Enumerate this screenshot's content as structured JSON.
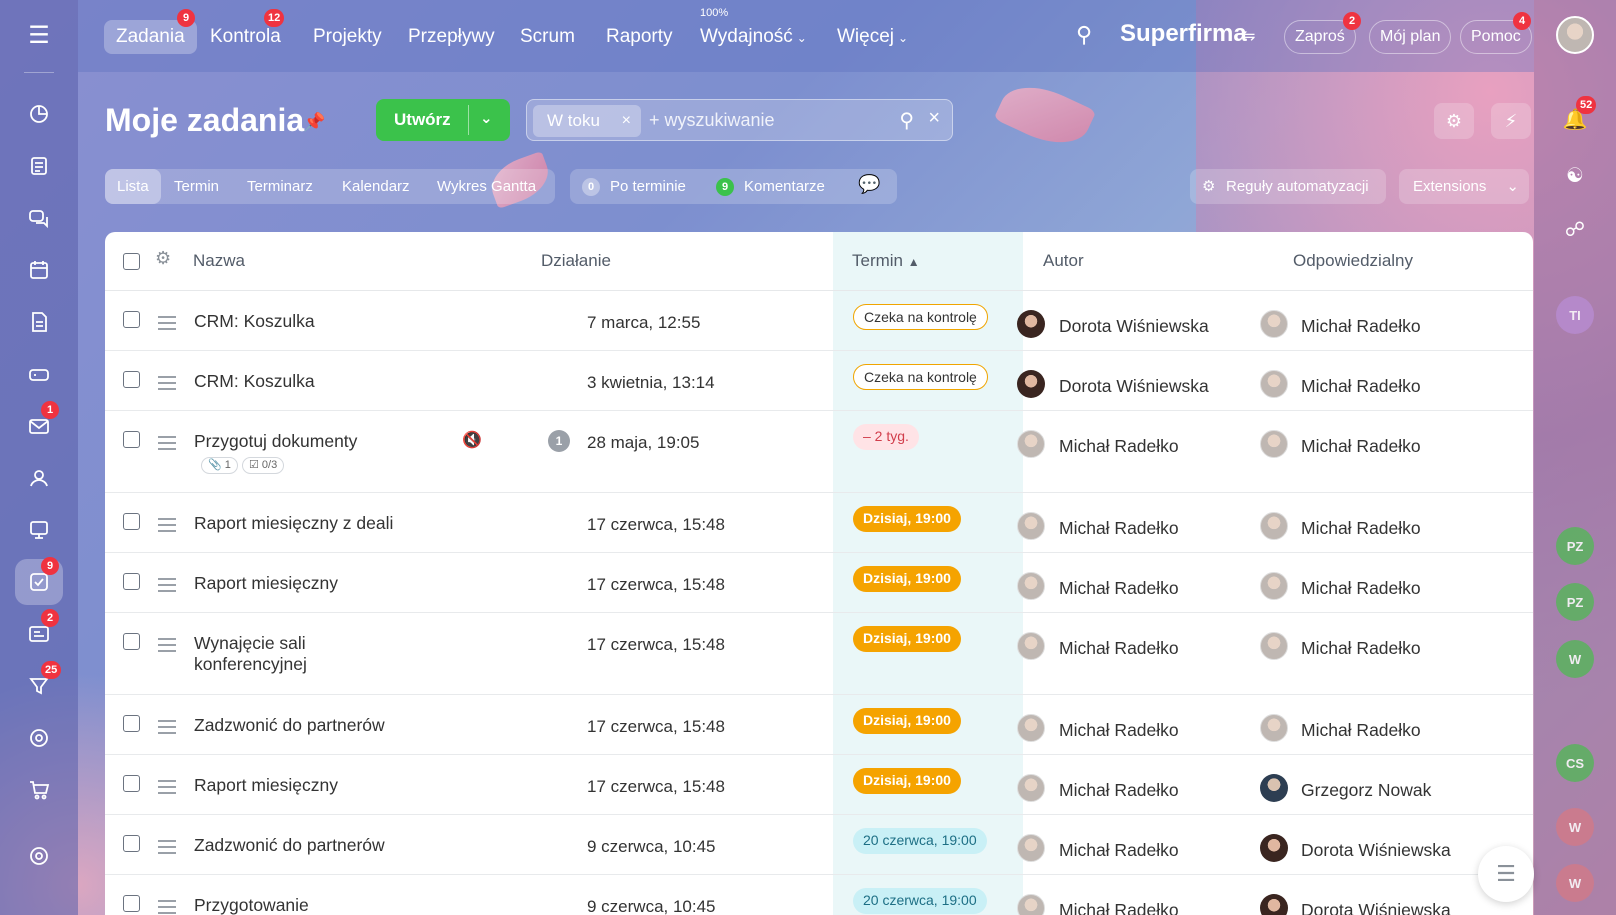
{
  "nav": {
    "tabs": [
      {
        "label": "Zadania",
        "badge": "9"
      },
      {
        "label": "Kontrola",
        "badge": "12"
      },
      {
        "label": "Projekty"
      },
      {
        "label": "Przepływy"
      },
      {
        "label": "Scrum"
      },
      {
        "label": "Raporty"
      },
      {
        "label": "Wydajność",
        "sup": "100%"
      },
      {
        "label": "Więcej"
      }
    ],
    "company": "Superfirma",
    "invite": "Zaproś",
    "invite_badge": "2",
    "my_plan": "Mój plan",
    "help": "Pomoc",
    "help_badge": "4"
  },
  "sidebar": {
    "items": [
      {
        "icon": "chart-icon"
      },
      {
        "icon": "feed-icon"
      },
      {
        "icon": "chat-icon"
      },
      {
        "icon": "calendar-icon"
      },
      {
        "icon": "document-icon"
      },
      {
        "icon": "drive-icon"
      },
      {
        "icon": "mail-icon",
        "badge": "1"
      },
      {
        "icon": "users-icon"
      },
      {
        "icon": "presentation-icon"
      },
      {
        "icon": "tasks-icon",
        "badge": "9"
      },
      {
        "icon": "crm-icon",
        "badge": "2"
      },
      {
        "icon": "funnel-icon",
        "badge": "25"
      },
      {
        "icon": "target-icon"
      },
      {
        "icon": "cart-icon"
      },
      {
        "icon": "settings-icon"
      }
    ]
  },
  "rightbar": {
    "notifications_badge": "52",
    "avatars": [
      "TI",
      "PZ",
      "PZ",
      "W",
      "CS",
      "W",
      "W"
    ]
  },
  "page": {
    "title": "Moje zadania",
    "create_label": "Utwórz",
    "filter_chip": "W toku",
    "search_placeholder": "+ wyszukiwanie"
  },
  "views": {
    "tabs": [
      "Lista",
      "Termin",
      "Terminarz",
      "Kalendarz",
      "Wykres Gantta"
    ],
    "overdue_count": "0",
    "overdue_label": "Po terminie",
    "comments_count": "9",
    "comments_label": "Komentarze",
    "automation_label": "Reguły automatyzacji",
    "extensions_label": "Extensions"
  },
  "grid": {
    "headers": {
      "name": "Nazwa",
      "action": "Działanie",
      "deadline": "Termin",
      "author": "Autor",
      "responsible": "Odpowiedzialny"
    },
    "rows": [
      {
        "name": "CRM: Koszulka",
        "action": "7 marca, 12:55",
        "deadline": "Czeka na kontrolę",
        "deadline_type": "kontrola",
        "author": "Dorota Wiśniewska",
        "author_av": "d",
        "responsible": "Michał Radełko",
        "resp_av": "m"
      },
      {
        "name": "CRM: Koszulka",
        "action": "3 kwietnia, 13:14",
        "deadline": "Czeka na kontrolę",
        "deadline_type": "kontrola",
        "author": "Dorota Wiśniewska",
        "author_av": "d",
        "responsible": "Michał Radełko",
        "resp_av": "m"
      },
      {
        "name": "Przygotuj dokumenty",
        "action": "28 maja, 19:05",
        "deadline": "– 2 tyg.",
        "deadline_type": "overdue",
        "author": "Michał Radełko",
        "author_av": "m",
        "responsible": "Michał Radełko",
        "resp_av": "m",
        "attachments": "1",
        "checklist": "0/3",
        "info_count": "1"
      },
      {
        "name": "Raport miesięczny z deali",
        "action": "17 czerwca, 15:48",
        "deadline": "Dzisiaj, 19:00",
        "deadline_type": "today",
        "author": "Michał Radełko",
        "author_av": "m",
        "responsible": "Michał Radełko",
        "resp_av": "m"
      },
      {
        "name": "Raport miesięczny",
        "action": "17 czerwca, 15:48",
        "deadline": "Dzisiaj, 19:00",
        "deadline_type": "today",
        "author": "Michał Radełko",
        "author_av": "m",
        "responsible": "Michał Radełko",
        "resp_av": "m"
      },
      {
        "name": "Wynajęcie sali",
        "name2": "konferencyjnej",
        "action": "17 czerwca, 15:48",
        "deadline": "Dzisiaj, 19:00",
        "deadline_type": "today",
        "author": "Michał Radełko",
        "author_av": "m",
        "responsible": "Michał Radełko",
        "resp_av": "m"
      },
      {
        "name": "Zadzwonić do partnerów",
        "action": "17 czerwca, 15:48",
        "deadline": "Dzisiaj, 19:00",
        "deadline_type": "today",
        "author": "Michał Radełko",
        "author_av": "m",
        "responsible": "Michał Radełko",
        "resp_av": "m"
      },
      {
        "name": "Raport miesięczny",
        "action": "17 czerwca, 15:48",
        "deadline": "Dzisiaj, 19:00",
        "deadline_type": "today",
        "author": "Michał Radełko",
        "author_av": "m",
        "responsible": "Grzegorz Nowak",
        "resp_av": "g"
      },
      {
        "name": "Zadzwonić do partnerów",
        "action": "9 czerwca, 10:45",
        "deadline": "20 czerwca, 19:00",
        "deadline_type": "future",
        "author": "Michał Radełko",
        "author_av": "m",
        "responsible": "Dorota Wiśniewska",
        "resp_av": "d"
      },
      {
        "name": "Przygotowanie",
        "action": "9 czerwca, 10:45",
        "deadline": "20 czerwca, 19:00",
        "deadline_type": "future",
        "author": "Michał Radełko",
        "author_av": "m",
        "responsible": "Dorota Wiśniewska",
        "resp_av": "d"
      }
    ]
  }
}
